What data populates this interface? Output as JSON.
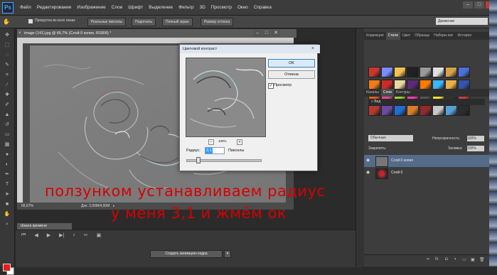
{
  "app": {
    "logo": "Ps"
  },
  "menu": [
    "Файл",
    "Редактирование",
    "Изображение",
    "Слои",
    "Шрифт",
    "Выделение",
    "Фильтр",
    "3D",
    "Просмотр",
    "Окно",
    "Справка"
  ],
  "options_bar": {
    "scroll_all_windows": "Прокрутка во всех окнах",
    "buttons": [
      "Реальные пикселы",
      "Подогнать",
      "Полный экран",
      "Размер оттиска"
    ],
    "workspace": "Движение"
  },
  "document": {
    "tab_title": "image (141).jpg @ 66,7% (Слой 0 копия, RGB/8) *",
    "zoom": "66,67%",
    "doc_info": "Док: 2,00M/4,00M"
  },
  "timeline": {
    "tab": "Шкала времени",
    "create_button": "Создать анимацию кадра"
  },
  "panels": {
    "top_tabs": [
      "Коррекция",
      "Стили",
      "Цвет",
      "Образцы",
      "Наборы кис",
      "История"
    ],
    "top_active": "Стили",
    "layers_tabs": [
      "Каналы",
      "Слои",
      "Контуры"
    ],
    "layers_active": "Слои",
    "kind": "Вид",
    "blend_mode": "Обычные",
    "opacity_label": "Непрозрачность:",
    "opacity_value": "100%",
    "lock_label": "Закрепить:",
    "fill_label": "Заливка:",
    "fill_value": "100%",
    "layers": [
      {
        "name": "Слой 0 копия",
        "selected": true
      },
      {
        "name": "Слой 0",
        "selected": false
      }
    ],
    "style_swatch_colors": [
      "#c9372c",
      "#7a8cff",
      "#f2c14e",
      "#222222",
      "#9a9a9a",
      "#e0e0e0",
      "#d6a24a",
      "#4a6fd6",
      "#f07c18",
      "#cc2b2b",
      "#e8d7a0",
      "#5b2b7a",
      "#ff7a00",
      "#3bb6ff",
      "#e9b04b",
      "#3355aa",
      "#ea5c1a",
      "#e64d8c",
      "#9ad03b",
      "#ff3db8",
      "#555555",
      "#ffdd33",
      "#333333",
      "#c04040",
      "#b23a2f",
      "#6b4aa1",
      "#1f6fd1",
      "#d97d2a",
      "#8e2b2b",
      "#c9c9c9",
      "#54a0d7",
      "#2c2c2c"
    ]
  },
  "dialog": {
    "title": "Цветовой контраст",
    "ok": "OK",
    "cancel": "Отмена",
    "preview_label": "Просмотр",
    "preview_checked": true,
    "zoom": "100%",
    "radius_label": "Радиус:",
    "radius_value": "3,1",
    "radius_unit": "Пикселы",
    "radius_slider_fraction": 0.15
  },
  "overlay": {
    "line1": "ползунком устанавливаем радиус",
    "line2": "у меня 3,1 и жмём ок"
  }
}
